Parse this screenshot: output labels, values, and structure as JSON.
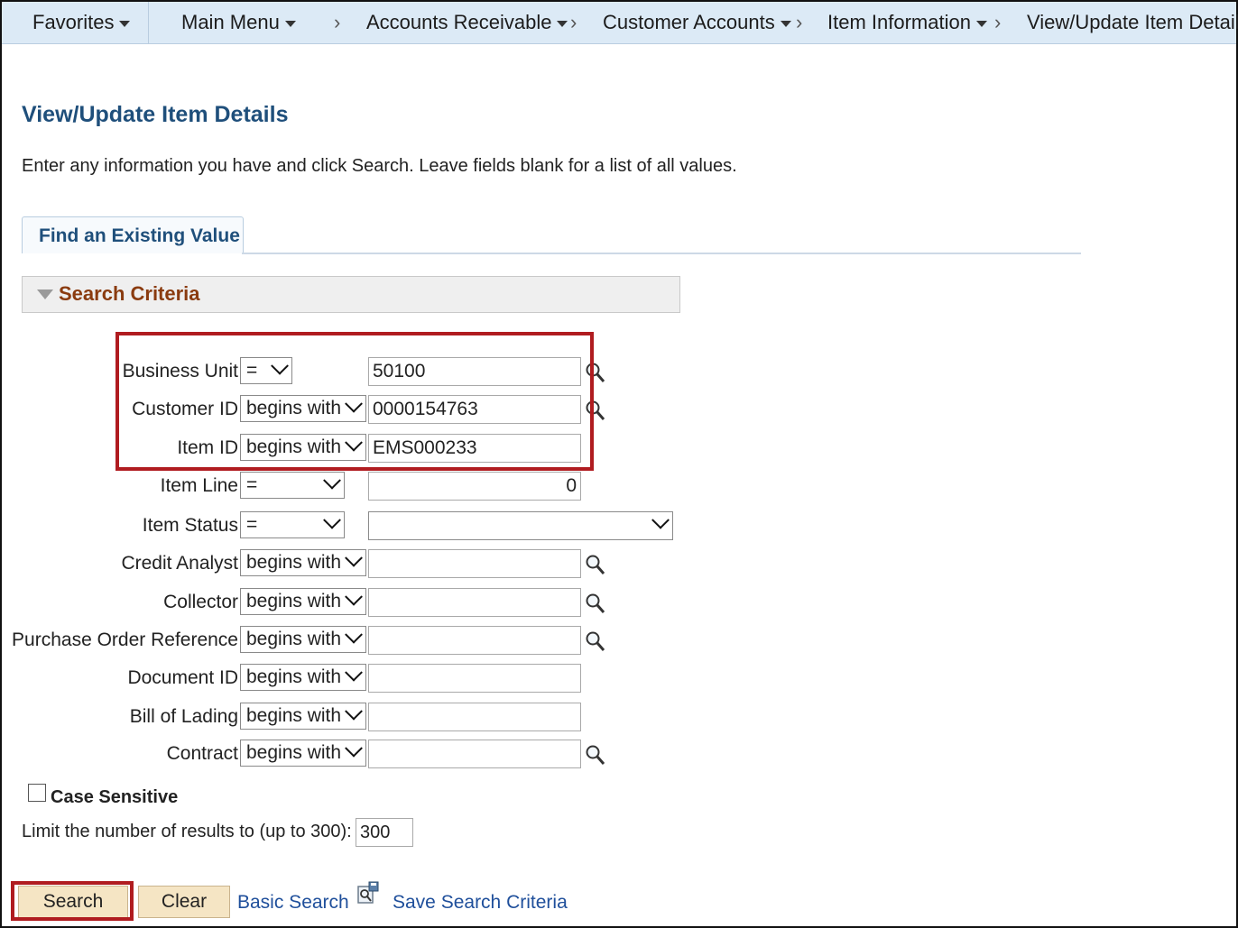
{
  "nav": {
    "favorites": "Favorites",
    "main_menu": "Main Menu",
    "accounts_receivable": "Accounts Receivable",
    "customer_accounts": "Customer Accounts",
    "item_information": "Item Information",
    "current": "View/Update Item Details",
    "separator": "›"
  },
  "page": {
    "title": "View/Update Item Details",
    "instructions": "Enter any information you have and click Search. Leave fields blank for a list of all values."
  },
  "tab": {
    "label": "Find an Existing Value"
  },
  "criteria": {
    "header": "Search Criteria"
  },
  "fields": {
    "business_unit": {
      "label": "Business Unit",
      "operator": "=",
      "value": "50100"
    },
    "customer_id": {
      "label": "Customer ID",
      "operator": "begins with",
      "value": "0000154763"
    },
    "item_id": {
      "label": "Item ID",
      "operator": "begins with",
      "value": "EMS000233"
    },
    "item_line": {
      "label": "Item Line",
      "operator": "=",
      "value": "0"
    },
    "item_status": {
      "label": "Item Status",
      "operator": "=",
      "value": ""
    },
    "credit_analyst": {
      "label": "Credit Analyst",
      "operator": "begins with",
      "value": ""
    },
    "collector": {
      "label": "Collector",
      "operator": "begins with",
      "value": ""
    },
    "purchase_order_reference": {
      "label": "Purchase Order Reference",
      "operator": "begins with",
      "value": ""
    },
    "document_id": {
      "label": "Document ID",
      "operator": "begins with",
      "value": ""
    },
    "bill_of_lading": {
      "label": "Bill of Lading",
      "operator": "begins with",
      "value": ""
    },
    "contract": {
      "label": "Contract",
      "operator": "begins with",
      "value": ""
    }
  },
  "options": {
    "case_sensitive_label": "Case Sensitive",
    "case_sensitive_checked": false,
    "limit_label": "Limit the number of results to (up to 300):",
    "limit_value": "300"
  },
  "actions": {
    "search": "Search",
    "clear": "Clear",
    "basic_search": "Basic Search",
    "save_search_criteria": "Save Search Criteria"
  },
  "colors": {
    "nav_bg": "#dceaf6",
    "title": "#1f4f7b",
    "criteria_header": "#8a3b0f",
    "button_bg": "#f5e5c4",
    "link": "#1f4f9b",
    "highlight": "#b01c20"
  }
}
